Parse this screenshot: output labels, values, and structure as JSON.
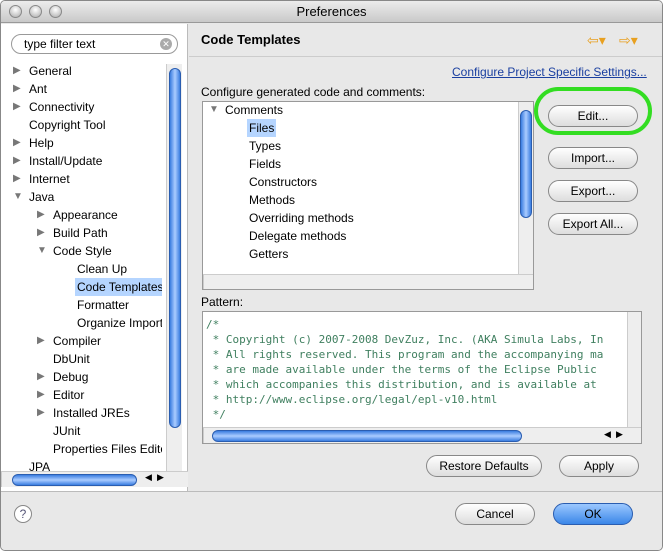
{
  "window": {
    "title": "Preferences"
  },
  "sidebar": {
    "filter_placeholder": "type filter text",
    "items": [
      {
        "label": "General",
        "level": 0,
        "arrow": "right"
      },
      {
        "label": "Ant",
        "level": 0,
        "arrow": "right"
      },
      {
        "label": "Connectivity",
        "level": 0,
        "arrow": "right"
      },
      {
        "label": "Copyright Tool",
        "level": 0,
        "arrow": ""
      },
      {
        "label": "Help",
        "level": 0,
        "arrow": "right"
      },
      {
        "label": "Install/Update",
        "level": 0,
        "arrow": "right"
      },
      {
        "label": "Internet",
        "level": 0,
        "arrow": "right"
      },
      {
        "label": "Java",
        "level": 0,
        "arrow": "down"
      },
      {
        "label": "Appearance",
        "level": 1,
        "arrow": "right"
      },
      {
        "label": "Build Path",
        "level": 1,
        "arrow": "right"
      },
      {
        "label": "Code Style",
        "level": 1,
        "arrow": "down"
      },
      {
        "label": "Clean Up",
        "level": 2,
        "arrow": ""
      },
      {
        "label": "Code Templates",
        "level": 2,
        "arrow": "",
        "selected": true
      },
      {
        "label": "Formatter",
        "level": 2,
        "arrow": ""
      },
      {
        "label": "Organize Imports",
        "level": 2,
        "arrow": ""
      },
      {
        "label": "Compiler",
        "level": 1,
        "arrow": "right"
      },
      {
        "label": "DbUnit",
        "level": 1,
        "arrow": ""
      },
      {
        "label": "Debug",
        "level": 1,
        "arrow": "right"
      },
      {
        "label": "Editor",
        "level": 1,
        "arrow": "right"
      },
      {
        "label": "Installed JREs",
        "level": 1,
        "arrow": "right"
      },
      {
        "label": "JUnit",
        "level": 1,
        "arrow": ""
      },
      {
        "label": "Properties Files Editor",
        "level": 1,
        "arrow": ""
      },
      {
        "label": "JPA",
        "level": 0,
        "arrow": ""
      }
    ]
  },
  "main": {
    "title": "Code Templates",
    "project_link": "Configure Project Specific Settings...",
    "configure_label": "Configure generated code and comments:",
    "templates": [
      {
        "label": "Comments",
        "level": 0
      },
      {
        "label": "Files",
        "level": 1,
        "selected": true
      },
      {
        "label": "Types",
        "level": 1
      },
      {
        "label": "Fields",
        "level": 1
      },
      {
        "label": "Constructors",
        "level": 1
      },
      {
        "label": "Methods",
        "level": 1
      },
      {
        "label": "Overriding methods",
        "level": 1
      },
      {
        "label": "Delegate methods",
        "level": 1
      },
      {
        "label": "Getters",
        "level": 1
      }
    ],
    "buttons": {
      "edit": "Edit...",
      "import": "Import...",
      "export": "Export...",
      "export_all": "Export All..."
    },
    "pattern_label": "Pattern:",
    "pattern_lines": [
      "/*",
      " * Copyright (c) 2007-2008 DevZuz, Inc. (AKA Simula Labs, In",
      " * All rights reserved. This program and the accompanying ma",
      " * are made available under the terms of the Eclipse Public ",
      " * which accompanies this distribution, and is available at ",
      " * http://www.eclipse.org/legal/epl-v10.html",
      " */"
    ],
    "restore_defaults": "Restore Defaults",
    "apply": "Apply"
  },
  "footer": {
    "help": "?",
    "cancel": "Cancel",
    "ok": "OK"
  },
  "colors": {
    "highlight": "#33dd22",
    "selection": "#b5d5ff",
    "comment": "#3f7f5f",
    "link": "#1a3fa0"
  }
}
